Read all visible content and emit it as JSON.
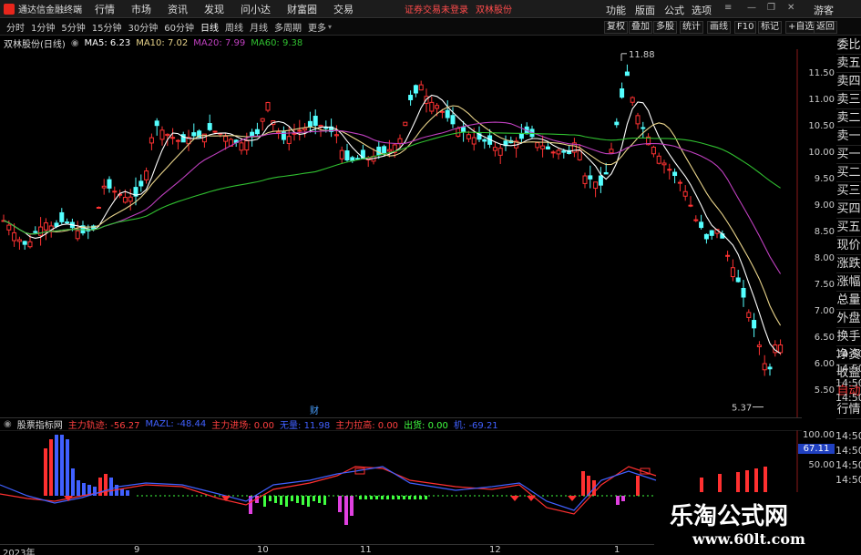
{
  "menubar": {
    "app_name": "通达信金融终端",
    "items": [
      "行情",
      "市场",
      "资讯",
      "发现",
      "问小达",
      "财富圈",
      "交易"
    ],
    "notice": "证券交易未登录",
    "stock": "双林股份",
    "right_items": [
      "功能",
      "版面",
      "公式",
      "选项"
    ],
    "guest": "游客"
  },
  "toolbar": {
    "periods": [
      "分时",
      "1分钟",
      "5分钟",
      "15分钟",
      "30分钟",
      "60分钟",
      "日线",
      "周线",
      "月线",
      "多周期",
      "更多"
    ],
    "right": [
      "复权",
      "叠加",
      "多股",
      "统计",
      "画线",
      "F10",
      "标记",
      "+自选",
      "返回"
    ]
  },
  "main_chart": {
    "title": "双林股份(日线)",
    "ma": [
      {
        "label": "MA5: 6.23",
        "color": "#ffffff"
      },
      {
        "label": "MA10: 7.02",
        "color": "#e8d38a"
      },
      {
        "label": "MA20: 7.99",
        "color": "#c040c0"
      },
      {
        "label": "MA60: 9.38",
        "color": "#30c030"
      }
    ],
    "high_label": "11.88",
    "low_label": "5.37",
    "marker": "财"
  },
  "price_axis": [
    "11.50",
    "11.00",
    "10.50",
    "10.00",
    "9.50",
    "9.00",
    "8.50",
    "8.00",
    "7.50",
    "7.00",
    "6.50",
    "6.00",
    "5.50"
  ],
  "right_panel": [
    "委比",
    "卖五",
    "卖四",
    "卖三",
    "卖二",
    "卖一",
    "买一",
    "买二",
    "买三",
    "买四",
    "买五",
    "现价",
    "涨跌",
    "涨幅",
    "总量",
    "外盘",
    "换手",
    "净资",
    "收益",
    "自动",
    "行情"
  ],
  "times": [
    "14:50",
    "14:50",
    "14:50",
    "14:50"
  ],
  "indicator": {
    "title": "股票指标网",
    "items": [
      {
        "label": "主力轨迹: -56.27",
        "color": "#ff4040"
      },
      {
        "label": "MAZL: -48.44",
        "color": "#4060ff"
      },
      {
        "label": "主力进场: 0.00",
        "color": "#ff4040"
      },
      {
        "label": "无量: 11.98",
        "color": "#4060ff"
      },
      {
        "label": "主力拉高: 0.00",
        "color": "#ff4040"
      },
      {
        "label": "出货: 0.00",
        "color": "#40ff40"
      },
      {
        "label": "机: -69.21",
        "color": "#4060ff"
      }
    ],
    "axis": [
      "100.00",
      "67.11",
      "50.00"
    ],
    "times": [
      "14:50",
      "14:50",
      "14:50",
      "14:50"
    ]
  },
  "date_axis": [
    "2023年",
    "9",
    "10",
    "11",
    "12",
    "1"
  ],
  "watermark": {
    "line1": "乐淘公式网",
    "line2": "www.60lt.com"
  },
  "chart_data": {
    "type": "candlestick",
    "y_range": [
      5.3,
      12.0
    ],
    "series": [
      {
        "name": "MA5",
        "values": []
      },
      {
        "name": "MA10",
        "values": []
      },
      {
        "name": "MA20",
        "values": []
      },
      {
        "name": "MA60",
        "values": []
      }
    ],
    "high": 11.88,
    "low": 5.37
  }
}
